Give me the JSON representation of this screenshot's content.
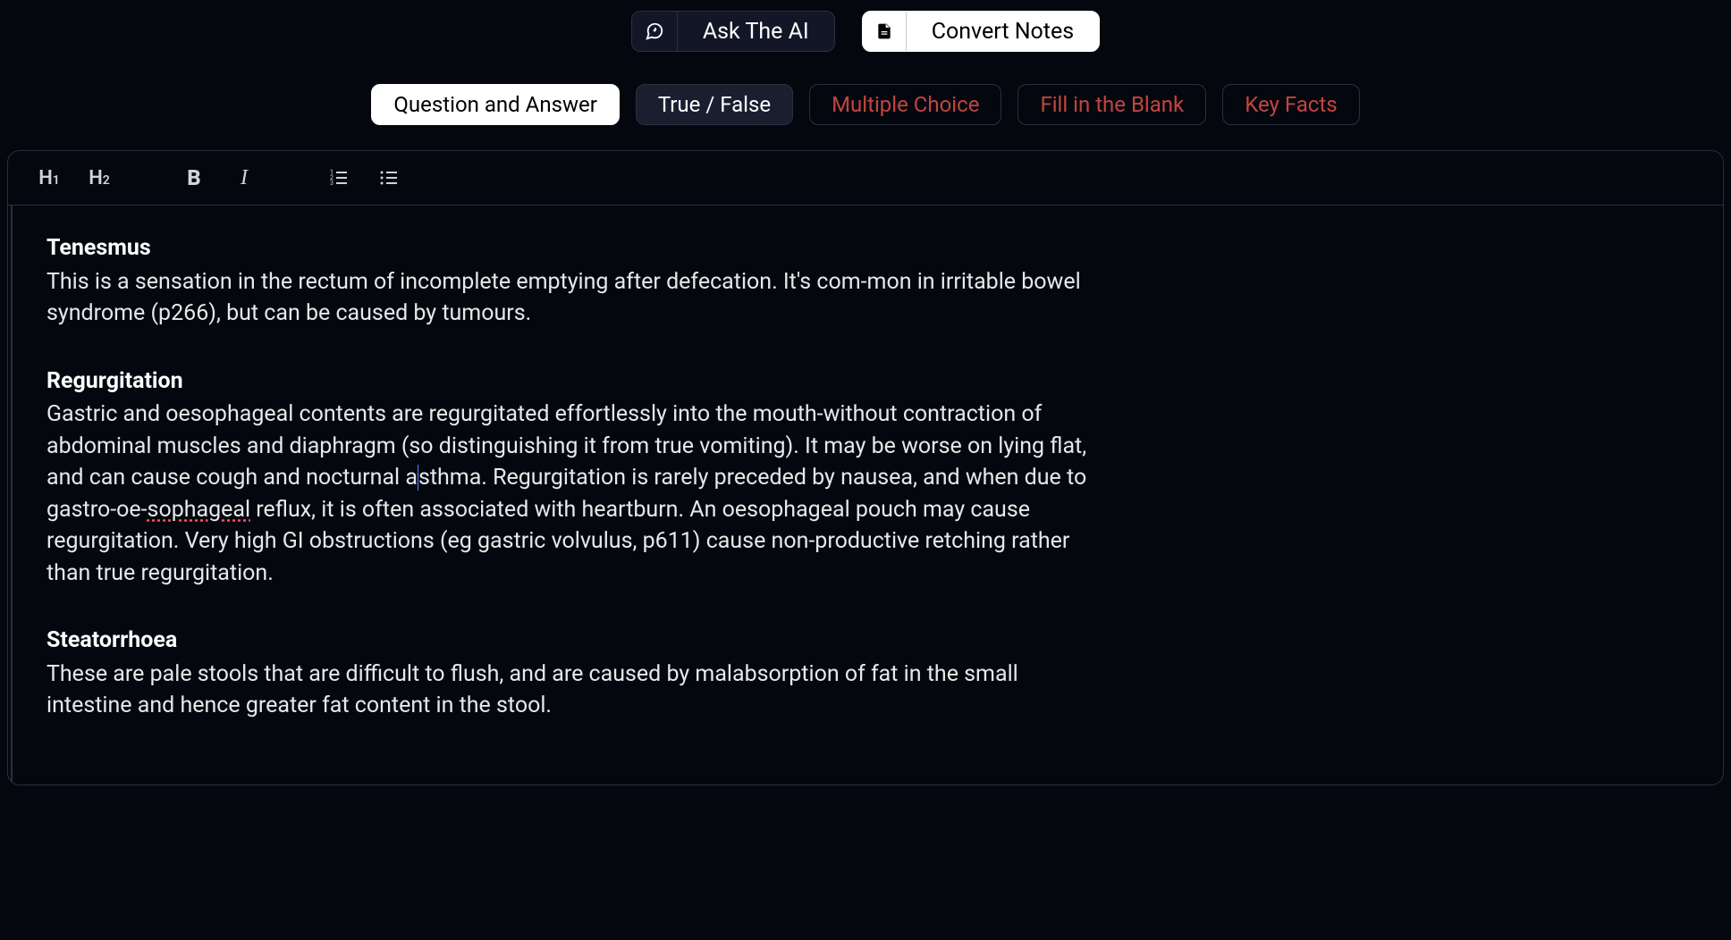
{
  "top_buttons": {
    "ask_ai_label": "Ask The AI",
    "convert_notes_label": "Convert Notes"
  },
  "tabs": {
    "qa_label": "Question and Answer",
    "tf_label": "True / False",
    "mc_label": "Multiple Choice",
    "fib_label": "Fill in the Blank",
    "kf_label": "Key Facts"
  },
  "toolbar": {
    "h1_label_main": "H",
    "h1_label_sub": "1",
    "h2_label_main": "H",
    "h2_label_sub": "2",
    "bold_label": "B",
    "italic_label": "I"
  },
  "sections": [
    {
      "title": "Tenesmus",
      "body": "This is a sensation in the rectum of incomplete emptying after defecation. It's com-mon in irritable bowel syndrome (p266), but can be caused by tumours."
    },
    {
      "title": "Regurgitation",
      "body_pre": "Gastric and oesophageal contents are regurgitated effortlessly into the mouth-without contraction of abdominal muscles and diaphragm (so distinguishing it from true vomiting). It may be worse on lying flat, and can cause cough and nocturnal a",
      "body_cursor": "sthma. Regurgitation is rarely preceded by nausea, and when due to gastro-oe-",
      "body_spell": "sophageal",
      "body_post": " reflux, it is often associated with heartburn. An oesophageal pouch may cause regurgitation. Very high GI obstructions (eg gastric volvulus, p611) cause non-productive retching rather than true regurgitation."
    },
    {
      "title": "Steatorrhoea",
      "body": "These are pale stools that are difficult to flush, and are caused by malabsorption of fat in the small intestine and hence greater fat content in the stool."
    }
  ]
}
